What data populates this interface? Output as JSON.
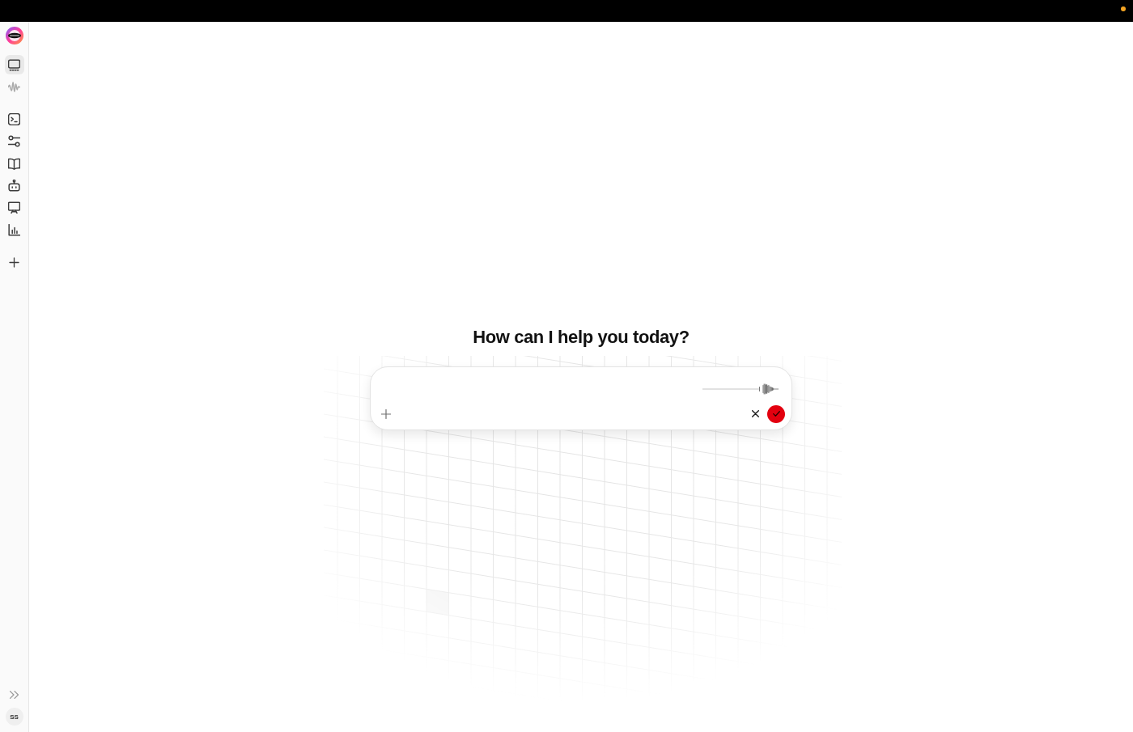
{
  "sidebar": {
    "groups": [
      {
        "items": [
          {
            "kind": "screen",
            "selected": true,
            "disabled": false
          },
          {
            "kind": "waveform",
            "selected": false,
            "disabled": true
          }
        ]
      },
      {
        "items": [
          {
            "kind": "terminal",
            "selected": false,
            "disabled": false
          },
          {
            "kind": "sliders",
            "selected": false,
            "disabled": false
          },
          {
            "kind": "book",
            "selected": false,
            "disabled": false
          },
          {
            "kind": "robot",
            "selected": false,
            "disabled": false
          },
          {
            "kind": "presentation",
            "selected": false,
            "disabled": false
          },
          {
            "kind": "chart",
            "selected": false,
            "disabled": false
          }
        ]
      },
      {
        "items": [
          {
            "kind": "add",
            "selected": false,
            "disabled": false
          }
        ]
      }
    ],
    "user": {
      "initials": "SS"
    }
  },
  "main": {
    "heading": "How can I help you today?",
    "composer": {
      "recording": true
    }
  }
}
